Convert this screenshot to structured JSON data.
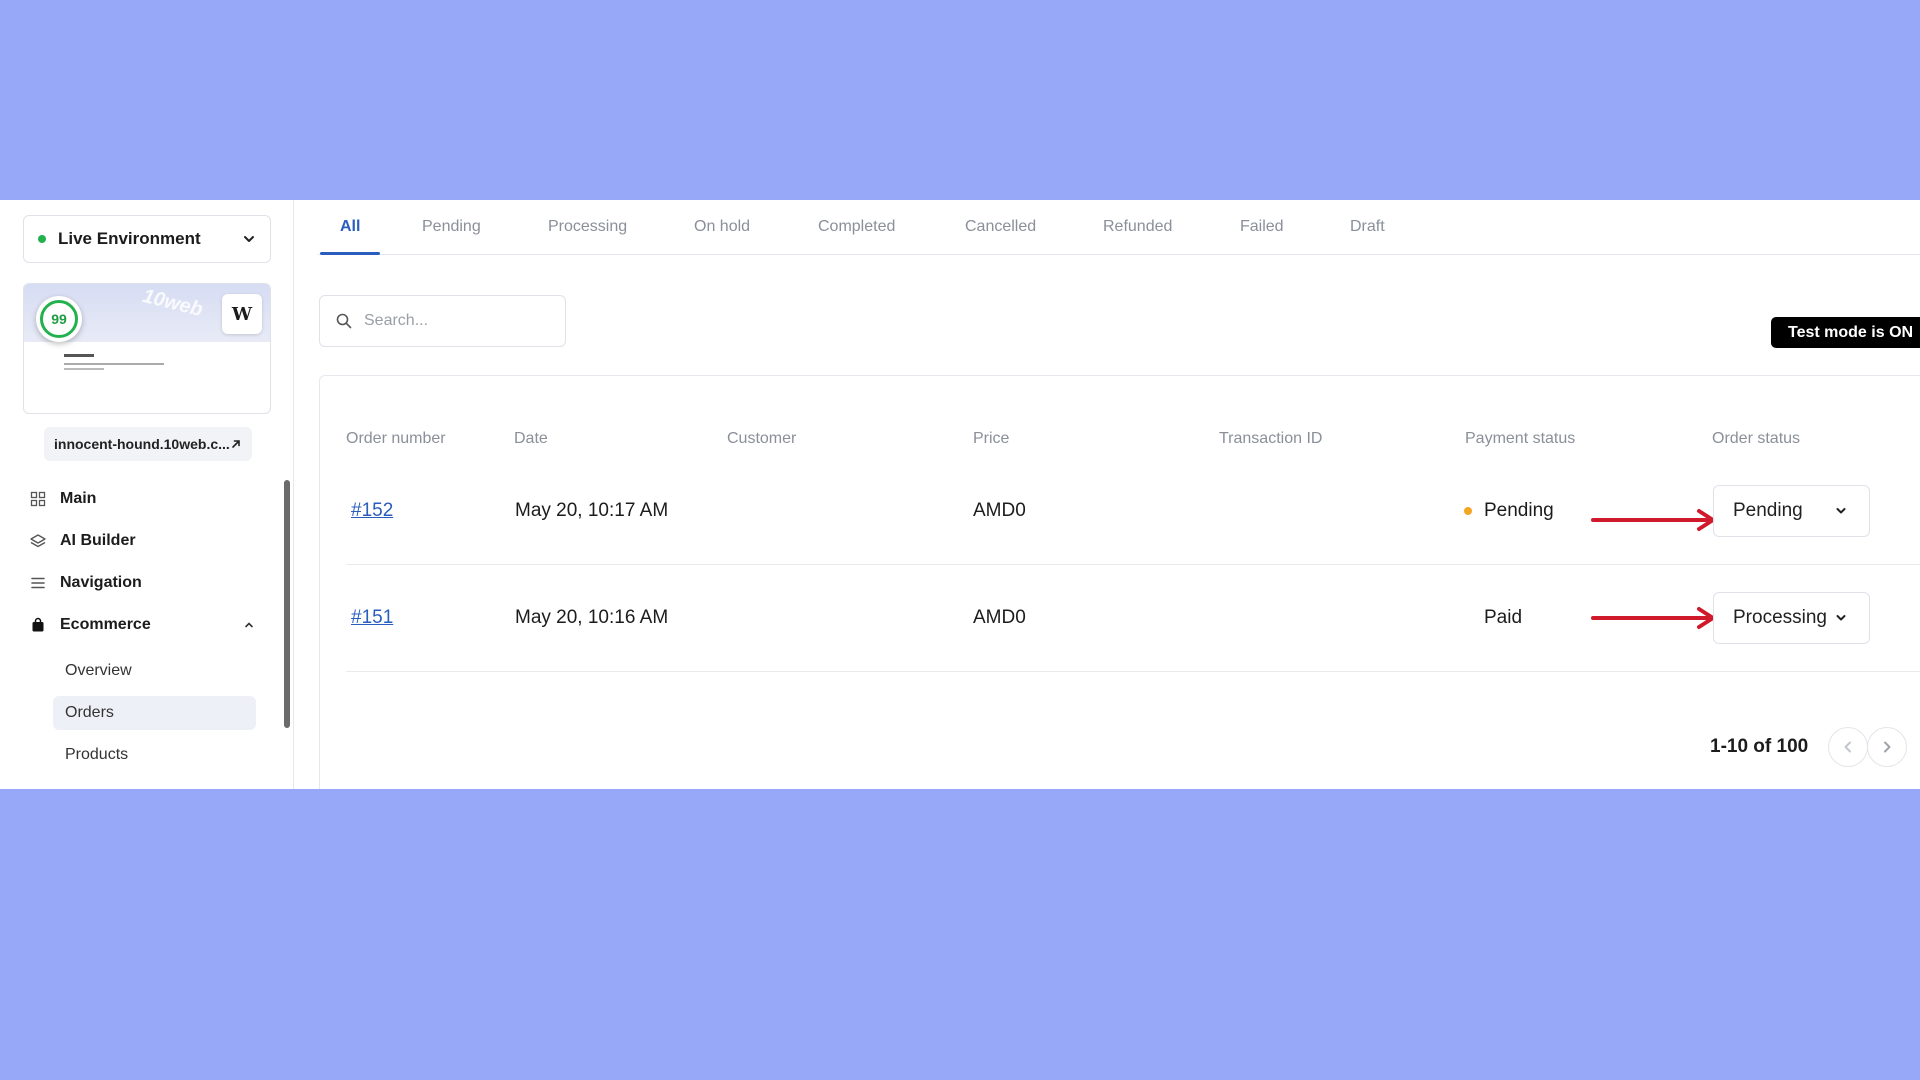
{
  "sidebar": {
    "environment": "Live Environment",
    "score": "99",
    "wp_badge": "W",
    "preview_watermark": "10web",
    "domain": "innocent-hound.10web.c...",
    "nav": [
      {
        "label": "Main",
        "icon": "grid-icon"
      },
      {
        "label": "AI Builder",
        "icon": "layers-icon"
      },
      {
        "label": "Navigation",
        "icon": "menu-icon"
      },
      {
        "label": "Ecommerce",
        "icon": "bag-icon"
      }
    ],
    "ecommerce_sub": [
      "Overview",
      "Orders",
      "Products"
    ]
  },
  "tabs": [
    "All",
    "Pending",
    "Processing",
    "On hold",
    "Completed",
    "Cancelled",
    "Refunded",
    "Failed",
    "Draft"
  ],
  "search": {
    "placeholder": "Search..."
  },
  "test_mode": "Test mode is ON",
  "table": {
    "headers": [
      "Order number",
      "Date",
      "Customer",
      "Price",
      "Transaction ID",
      "Payment status",
      "Order status"
    ],
    "rows": [
      {
        "order": "#152",
        "date": "May 20, 10:17 AM",
        "customer": "",
        "price": "AMD0",
        "transaction": "",
        "payment": "Pending",
        "status": "Pending"
      },
      {
        "order": "#151",
        "date": "May 20, 10:16 AM",
        "customer": "",
        "price": "AMD0",
        "transaction": "",
        "payment": "Paid",
        "status": "Processing"
      }
    ]
  },
  "pagination": {
    "text": "1-10 of 100"
  },
  "colors": {
    "accent": "#2a5dbe",
    "background": "#97a8f9",
    "arrow": "#d0192a",
    "pending_dot": "#f5a524",
    "live_dot": "#22b14c"
  }
}
